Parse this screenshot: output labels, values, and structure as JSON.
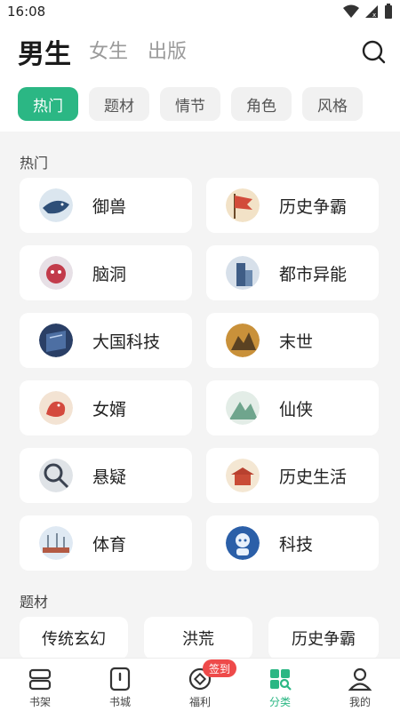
{
  "status_bar": {
    "time": "16:08"
  },
  "header": {
    "tabs": [
      {
        "label": "男生",
        "active": true
      },
      {
        "label": "女生",
        "active": false
      },
      {
        "label": "出版",
        "active": false
      }
    ],
    "search_icon": "search-icon"
  },
  "filters": [
    {
      "label": "热门",
      "active": true
    },
    {
      "label": "题材",
      "active": false
    },
    {
      "label": "情节",
      "active": false
    },
    {
      "label": "角色",
      "active": false
    },
    {
      "label": "风格",
      "active": false
    }
  ],
  "sections": {
    "hot": {
      "title": "热门",
      "items": [
        {
          "label": "御兽",
          "icon": "whale-icon"
        },
        {
          "label": "历史争霸",
          "icon": "war-flag-icon"
        },
        {
          "label": "脑洞",
          "icon": "pig-icon"
        },
        {
          "label": "都市异能",
          "icon": "city-tower-icon"
        },
        {
          "label": "大国科技",
          "icon": "tech-book-icon"
        },
        {
          "label": "末世",
          "icon": "ruins-icon"
        },
        {
          "label": "女婿",
          "icon": "dragon-icon"
        },
        {
          "label": "仙侠",
          "icon": "mountain-icon"
        },
        {
          "label": "悬疑",
          "icon": "lens-icon"
        },
        {
          "label": "历史生活",
          "icon": "palace-icon"
        },
        {
          "label": "体育",
          "icon": "stadium-icon"
        },
        {
          "label": "科技",
          "icon": "robot-icon"
        }
      ]
    },
    "theme": {
      "title": "题材",
      "items": [
        "传统玄幻",
        "洪荒",
        "历史争霸"
      ]
    }
  },
  "bottom_nav": {
    "items": [
      {
        "label": "书架",
        "icon": "bookshelf-icon",
        "active": false
      },
      {
        "label": "书城",
        "icon": "bookstore-icon",
        "active": false
      },
      {
        "label": "福利",
        "icon": "coin-icon",
        "active": false
      },
      {
        "label": "分类",
        "icon": "category-icon",
        "active": true
      },
      {
        "label": "我的",
        "icon": "profile-icon",
        "active": false
      }
    ],
    "badge": "签到"
  },
  "colors": {
    "accent": "#2bb784",
    "badge": "#ee4a4a",
    "background": "#f4f4f4"
  }
}
